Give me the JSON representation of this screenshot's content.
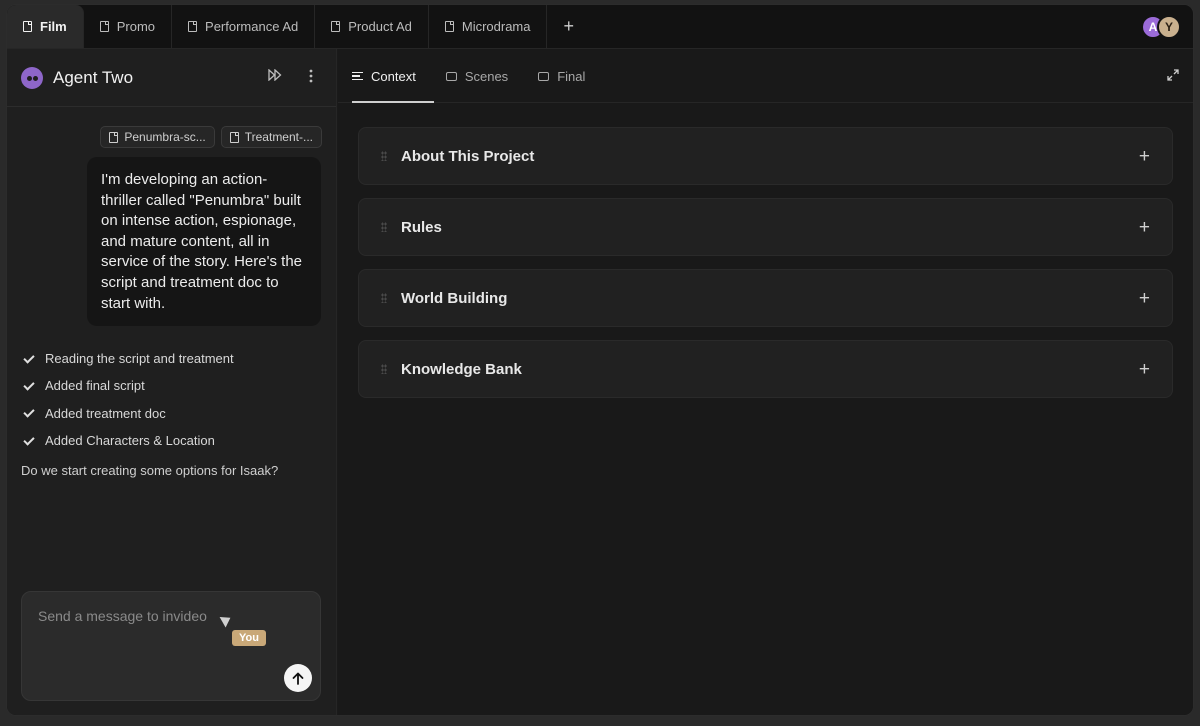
{
  "tabs": [
    {
      "label": "Film",
      "active": true
    },
    {
      "label": "Promo",
      "active": false
    },
    {
      "label": "Performance Ad",
      "active": false
    },
    {
      "label": "Product Ad",
      "active": false
    },
    {
      "label": "Microdrama",
      "active": false
    }
  ],
  "add_tab_label": "+",
  "avatars": [
    "A",
    "Y"
  ],
  "agent": {
    "name": "Agent Two",
    "skip_icon": "fast-forward-icon",
    "more_icon": "more-vertical-icon"
  },
  "attachments": [
    "Penumbra-sc...",
    "Treatment-..."
  ],
  "user_message": "I'm developing an action-thriller called \"Penumbra\" built on intense action, espionage, and mature content, all in service of the story. Here's the script and treatment doc to start with.",
  "tasks": [
    "Reading the script and treatment",
    "Added final script",
    "Added treatment doc",
    "Added Characters & Location"
  ],
  "agent_question": "Do we start creating some options for Isaak?",
  "composer": {
    "placeholder": "Send a message to invideo",
    "cursor_tag": "You",
    "send_icon": "arrow-up-icon"
  },
  "context_tabs": [
    {
      "label": "Context",
      "active": true,
      "icon": "list-icon"
    },
    {
      "label": "Scenes",
      "active": false,
      "icon": "folder-icon"
    },
    {
      "label": "Final",
      "active": false,
      "icon": "folder-icon"
    }
  ],
  "sections": [
    {
      "title": "About This Project"
    },
    {
      "title": "Rules"
    },
    {
      "title": "World Building"
    },
    {
      "title": "Knowledge Bank"
    }
  ],
  "colors": {
    "accent_purple": "#8e66c9",
    "cursor_tag": "#c9a878",
    "background": "#1a1a1a"
  }
}
